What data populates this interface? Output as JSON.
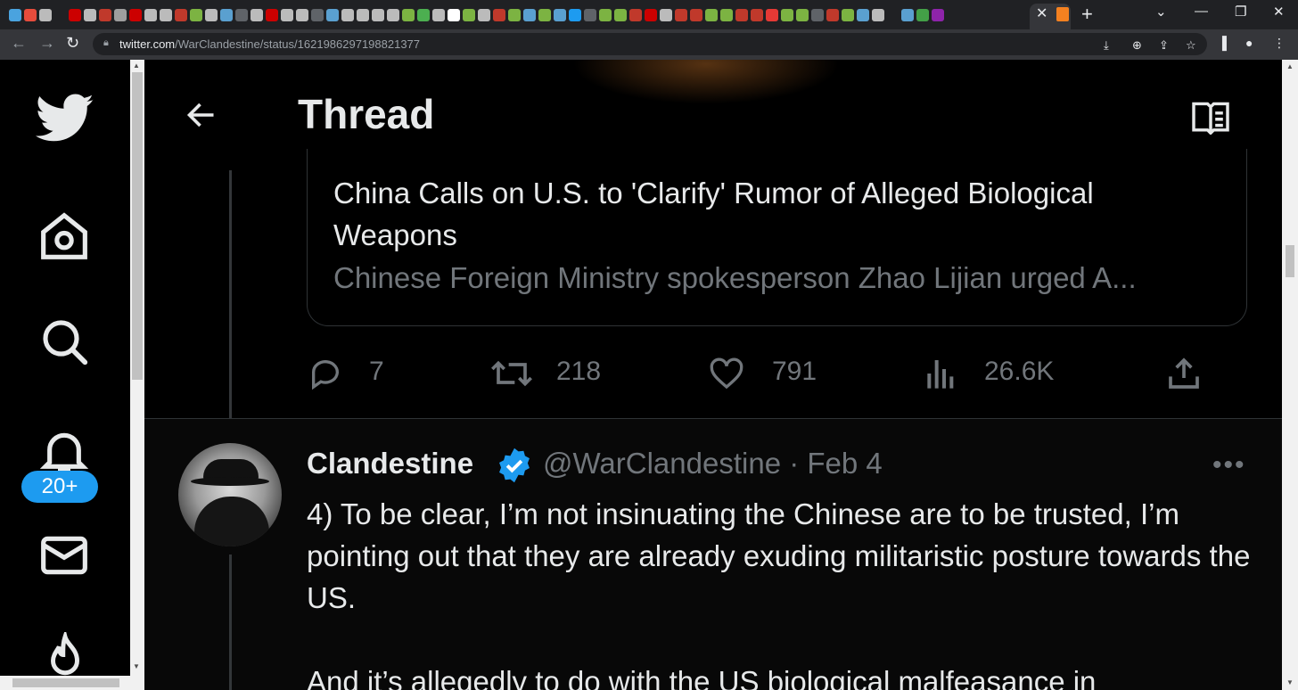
{
  "browser": {
    "url_host": "twitter.com",
    "url_path": "/WarClandestine/status/1621986297198821377",
    "tab_colors": [
      "#4aa3df",
      "#e74c3c",
      "#bbbbbb",
      "#cc0000",
      "#bbbbbb",
      "#c0392b",
      "#9e9e9e",
      "#cc0000",
      "#bbbbbb",
      "#bbbbbb",
      "#c0392b",
      "#7cb342",
      "#bbbbbb",
      "#5aa0d0",
      "#5f6368",
      "#bbbbbb",
      "#cc0000",
      "#bbbbbb",
      "#bbbbbb",
      "#5f6368",
      "#5aa0d0",
      "#bbbbbb",
      "#bbbbbb",
      "#bbbbbb",
      "#bbbbbb",
      "#7cb342",
      "#4caf50",
      "#bbbbbb",
      "#ffffff",
      "#7cb342",
      "#bbbbbb",
      "#c0392b",
      "#7cb342",
      "#5aa0d0",
      "#7cb342",
      "#5aa0d0",
      "#1d9bf0",
      "#5f6368",
      "#7cb342",
      "#7cb342",
      "#c0392b",
      "#cc0000",
      "#bbbbbb",
      "#c0392b",
      "#c0392b",
      "#7cb342",
      "#7cb342",
      "#c0392b",
      "#c0392b",
      "#e53935",
      "#7cb342",
      "#7cb342",
      "#5f6368",
      "#c0392b",
      "#7cb342",
      "#5aa0d0",
      "#bbbbbb",
      "#5aa0d0",
      "#43a047",
      "#8e24aa"
    ]
  },
  "sidebar": {
    "notifications_badge": "20+",
    "icons": [
      "twitter-logo-icon",
      "home-icon",
      "search-icon",
      "notifications-bell-icon",
      "messages-icon",
      "topics-flame-icon"
    ]
  },
  "header": {
    "title": "Thread"
  },
  "card": {
    "title": "China Calls on U.S. to 'Clarify' Rumor of Alleged Biological Weapons",
    "description": "Chinese Foreign Ministry spokesperson Zhao Lijian urged A..."
  },
  "actions": {
    "replies": "7",
    "retweets": "218",
    "likes": "791",
    "views": "26.6K"
  },
  "tweet": {
    "name": "Clandestine",
    "handle_date": "@WarClandestine · Feb 4",
    "more": "•••",
    "para1": "4) To be clear, I’m not insinuating the Chinese are to be trusted, I’m pointing out that they are already exuding militaristic posture towards the US.",
    "para2": "And it’s allegedly to do with the US biological malfeasance in"
  },
  "colors": {
    "accent": "#1d9bf0",
    "text": "#e7e9ea",
    "muted": "#71767b",
    "border": "#2f3336"
  }
}
